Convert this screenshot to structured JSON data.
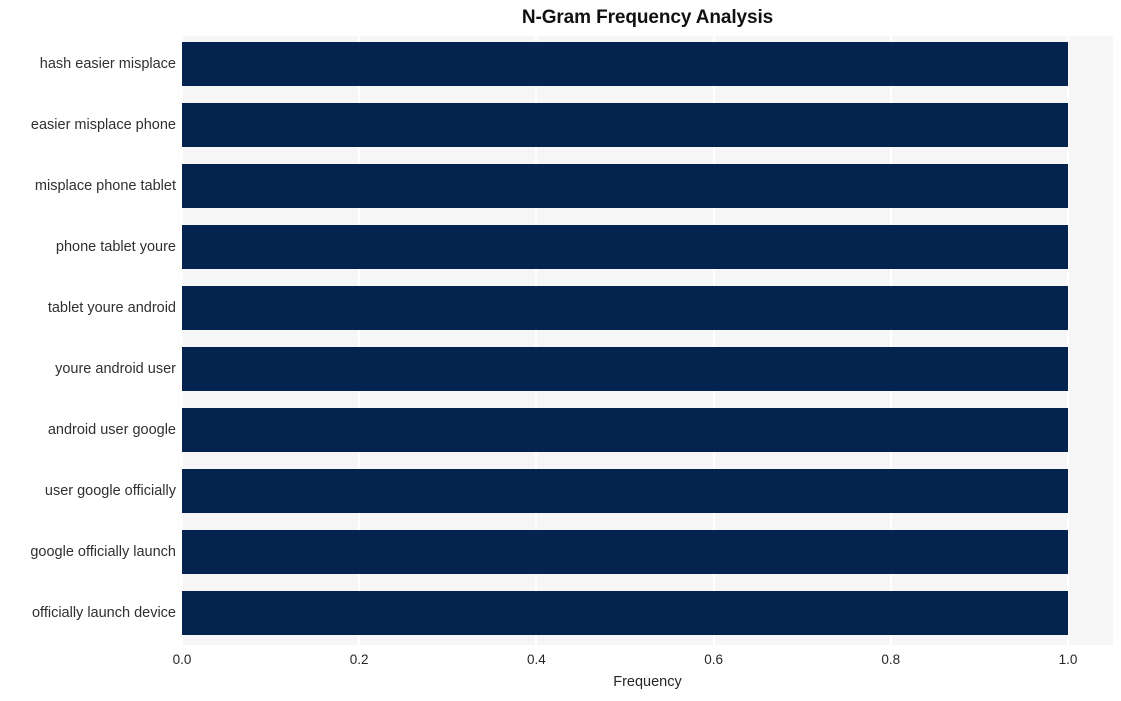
{
  "chart_data": {
    "type": "bar",
    "orientation": "horizontal",
    "title": "N-Gram Frequency Analysis",
    "xlabel": "Frequency",
    "ylabel": "",
    "categories": [
      "hash easier misplace",
      "easier misplace phone",
      "misplace phone tablet",
      "phone tablet youre",
      "tablet youre android",
      "youre android user",
      "android user google",
      "user google officially",
      "google officially launch",
      "officially launch device"
    ],
    "values": [
      1.0,
      1.0,
      1.0,
      1.0,
      1.0,
      1.0,
      1.0,
      1.0,
      1.0,
      1.0
    ],
    "xlim": [
      0.0,
      1.0
    ],
    "xticks": [
      "0.0",
      "0.2",
      "0.4",
      "0.6",
      "0.8",
      "1.0"
    ],
    "xtick_values": [
      0.0,
      0.2,
      0.4,
      0.6,
      0.8,
      1.0
    ],
    "grid": "vertical",
    "legend": null,
    "bar_color": "#04234f",
    "plot_background": "#f6f6f7",
    "figure_background": "#ffffff",
    "gridline_color": "#ffffff"
  }
}
